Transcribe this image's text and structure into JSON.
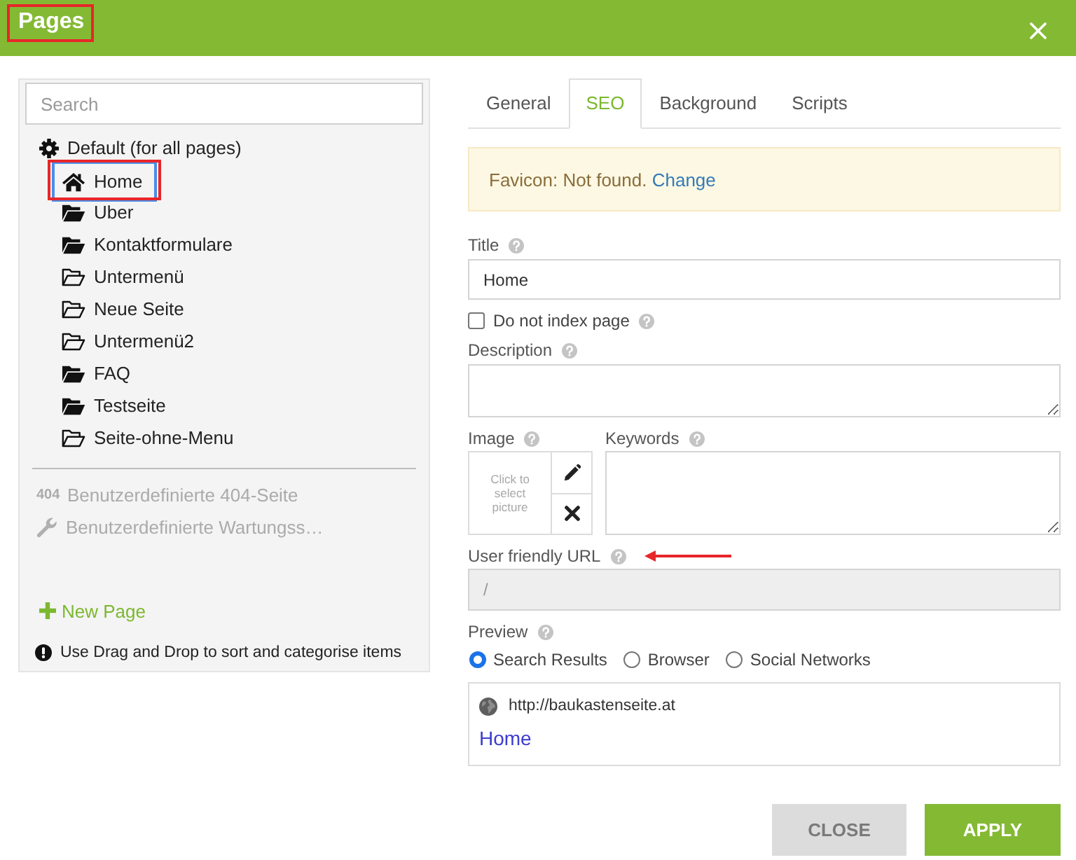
{
  "header": {
    "title": "Pages",
    "highlighted": true
  },
  "sidebar": {
    "search": {
      "placeholder": "Search"
    },
    "tree": [
      {
        "label": "Default (for all pages)",
        "kind": "settings",
        "selected": false,
        "highlighted": false,
        "children": [
          {
            "label": "Home",
            "kind": "home",
            "selected": true,
            "highlighted": true
          },
          {
            "label": "Uber",
            "kind": "folder_filled",
            "selected": false,
            "highlighted": false
          },
          {
            "label": "Kontaktformulare",
            "kind": "folder_filled",
            "selected": false,
            "highlighted": false
          },
          {
            "label": "Untermenü",
            "kind": "folder_outline",
            "selected": false,
            "highlighted": false
          },
          {
            "label": "Neue Seite",
            "kind": "folder_outline",
            "selected": false,
            "highlighted": false
          },
          {
            "label": "Untermenü2",
            "kind": "folder_outline",
            "selected": false,
            "highlighted": false
          },
          {
            "label": "FAQ",
            "kind": "folder_filled",
            "selected": false,
            "highlighted": false
          },
          {
            "label": "Testseite",
            "kind": "folder_filled",
            "selected": false,
            "highlighted": false
          },
          {
            "label": "Seite-ohne-Menu",
            "kind": "folder_outline",
            "selected": false,
            "highlighted": false
          }
        ]
      }
    ],
    "special_pages": [
      {
        "badge": "404",
        "label": "Benutzerdefinierte 404-Seite",
        "kind": "badge",
        "disabled": true
      },
      {
        "label": "Benutzerdefinierte Wartungss…",
        "kind": "wrench",
        "disabled": true
      }
    ],
    "new_page": "New Page",
    "hint": "Use Drag and Drop to sort and categorise items"
  },
  "tabs": [
    {
      "label": "General",
      "selected": false
    },
    {
      "label": "SEO",
      "selected": true
    },
    {
      "label": "Background",
      "selected": false
    },
    {
      "label": "Scripts",
      "selected": false
    }
  ],
  "alert": {
    "text": "Favicon: Not found.",
    "link": "Change"
  },
  "form": {
    "title": {
      "label": "Title",
      "value": "Home"
    },
    "noindex": {
      "label": "Do not index page",
      "checked": false
    },
    "description": {
      "label": "Description"
    },
    "image": {
      "label": "Image",
      "prompt": "Click to select picture"
    },
    "keywords": {
      "label": "Keywords"
    },
    "url": {
      "label": "User friendly URL",
      "value": "/",
      "disabled": true,
      "pointer_arrow": true
    }
  },
  "preview": {
    "label": "Preview",
    "options": [
      {
        "label": "Search Results",
        "selected": true
      },
      {
        "label": "Browser",
        "selected": false
      },
      {
        "label": "Social Networks",
        "selected": false
      }
    ],
    "url": "http://baukastenseite.at",
    "page_title": "Home"
  },
  "buttons": [
    {
      "label": "CLOSE",
      "kind": "secondary"
    },
    {
      "label": "APPLY",
      "kind": "primary"
    }
  ]
}
